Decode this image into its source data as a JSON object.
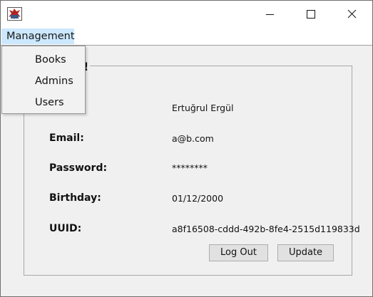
{
  "menubar": {
    "management_label": "Management",
    "items": [
      "Books",
      "Admins",
      "Users"
    ]
  },
  "panel": {
    "title_fragment": "!"
  },
  "fields": {
    "name_value": "Ertuğrul Ergül",
    "email_label": "Email:",
    "email_value": "a@b.com",
    "password_label": "Password:",
    "password_value": "********",
    "birthday_label": "Birthday:",
    "birthday_value": "01/12/2000",
    "uuid_label": "UUID:",
    "uuid_value": "a8f16508-cddd-492b-8fe4-2515d119833d"
  },
  "buttons": {
    "logout_label": "Log Out",
    "update_label": "Update"
  },
  "colors": {
    "menu_highlight": "#cce8ff",
    "window_background": "#f0f0f0",
    "titlebar_background": "#ffffff"
  },
  "icons": {
    "app": "java-app-icon",
    "minimize": "minimize-icon",
    "maximize": "maximize-icon",
    "close": "close-icon"
  }
}
